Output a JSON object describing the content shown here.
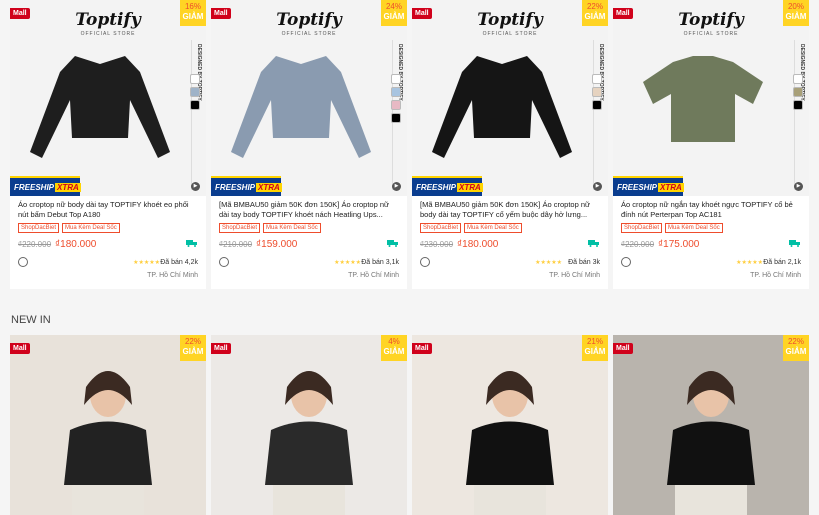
{
  "section_title": "NEW IN",
  "badges": {
    "mall": "Mall",
    "discount_label": "GIẢM"
  },
  "brand": {
    "name": "Toptify",
    "sub": "OFFICIAL STORE",
    "side": "DESIGNED BY TOPTIFY"
  },
  "freeship": {
    "text": "FREESHIP",
    "xtra": "XTRA"
  },
  "products": [
    {
      "discount": "16%",
      "title": "Áo croptop nữ body dài tay TOPTIFY khoét eo phối nút bấm Debut Top A180",
      "tags": [
        "ShopDacBiet",
        "Mua Kèm Deal Sốc"
      ],
      "old_price": "₫220.000",
      "price": "₫180.000",
      "rating_stars": "★★★★★",
      "sold": "Đã bán 4,2k",
      "location": "TP. Hồ Chí Minh",
      "swatches": [
        "#ffffff",
        "#9fb3c8",
        "#000000"
      ],
      "shirt_color": "#1e1e1e"
    },
    {
      "discount": "24%",
      "title": "[Mã BMBAU50 giảm 50K đơn 150K] Áo croptop nữ dài tay body TOPTIFY khoét nách Heatling Ups...",
      "tags": [
        "ShopDacBiet",
        "Mua Kèm Deal Sốc"
      ],
      "old_price": "₫210.000",
      "price": "₫159.000",
      "rating_stars": "★★★★★",
      "sold": "Đã bán 3,1k",
      "location": "TP. Hồ Chí Minh",
      "swatches": [
        "#ffffff",
        "#a8c4e0",
        "#e7b9c4",
        "#000000"
      ],
      "shirt_color": "#8a9bb0"
    },
    {
      "discount": "22%",
      "title": "[Mã BMBAU50 giảm 50K đơn 150K] Áo croptop nữ body dài tay TOPTIFY cổ yếm buộc dây hở lưng...",
      "tags": [
        "ShopDacBiet",
        "Mua Kèm Deal Sốc"
      ],
      "old_price": "₫230.000",
      "price": "₫180.000",
      "rating_stars": "★★★★★",
      "sold": "Đã bán 3k",
      "location": "TP. Hồ Chí Minh",
      "swatches": [
        "#ffffff",
        "#e6d3c0",
        "#000000"
      ],
      "shirt_color": "#151515"
    },
    {
      "discount": "20%",
      "title": "Áo croptop nữ ngắn tay khoét ngực TOPTIFY cổ bẻ đính nút Perterpan Top AC181",
      "tags": [
        "ShopDacBiet",
        "Mua Kèm Deal Sốc"
      ],
      "old_price": "₫220.000",
      "price": "₫175.000",
      "rating_stars": "★★★★★",
      "sold": "Đã bán 2,1k",
      "location": "TP. Hồ Chí Minh",
      "swatches": [
        "#ffffff",
        "#a8a079",
        "#000000"
      ],
      "shirt_color": "#6f7a5c"
    }
  ],
  "new_in": [
    {
      "discount": "22%",
      "bg": "#e8e2da",
      "top": "#222222"
    },
    {
      "discount": "4%",
      "bg": "#ece9e6",
      "top": "#2a2a2a"
    },
    {
      "discount": "21%",
      "bg": "#ede7e0",
      "top": "#111111"
    },
    {
      "discount": "22%",
      "bg": "#b9b4ad",
      "top": "#111111"
    }
  ]
}
